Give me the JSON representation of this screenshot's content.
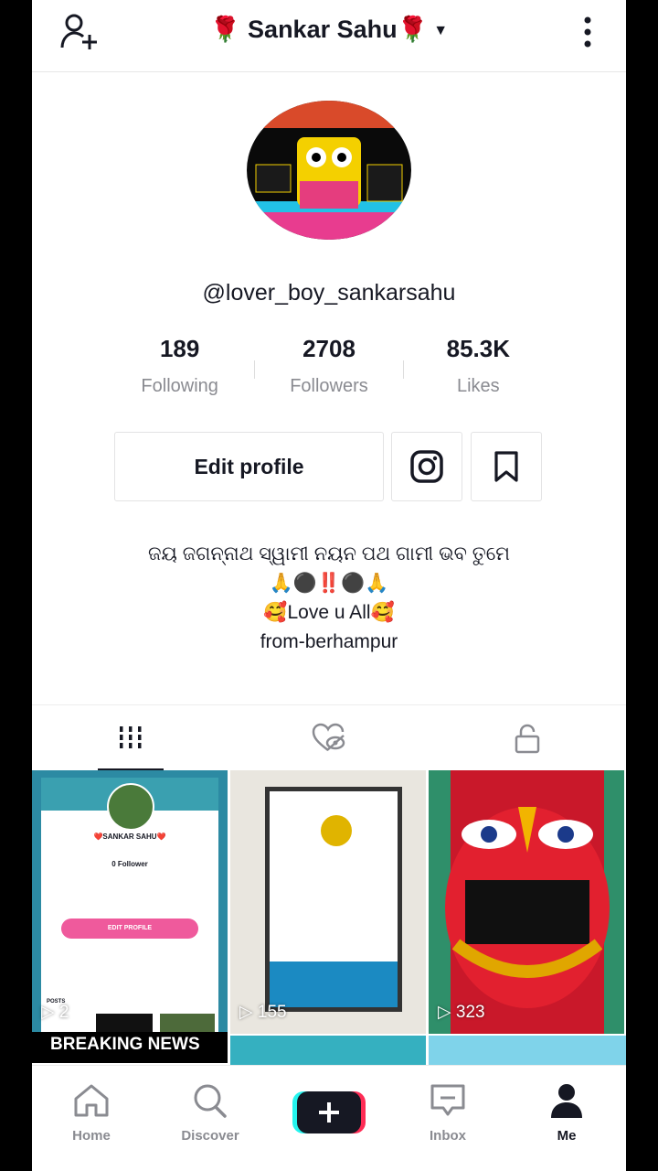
{
  "header": {
    "title": "🌹 Sankar Sahu🌹",
    "caret": "▼"
  },
  "profile": {
    "handle": "@lover_boy_sankarsahu",
    "stats": [
      {
        "value": "189",
        "label": "Following"
      },
      {
        "value": "2708",
        "label": "Followers"
      },
      {
        "value": "85.3K",
        "label": "Likes"
      }
    ],
    "edit_label": "Edit profile",
    "bio_lines": [
      "ଜୟ ଜଗନ୍ନାଥ ସ୍ୱାମୀ ନୟନ ପଥ ଗାମୀ ଭବ ତୁମେ",
      "🙏⚫‼️⚫🙏",
      "🥰Love u All🥰",
      "from-berhampur"
    ]
  },
  "videos": [
    {
      "views": "2",
      "overlay": "BREAKING NEWS",
      "inner_name": "❤️SANKAR SAHU❤️",
      "inner_followers": "0 Follower",
      "inner_button": "EDIT PROFILE",
      "inner_posts": "POSTS"
    },
    {
      "views": "155"
    },
    {
      "views": "323"
    }
  ],
  "nav": [
    {
      "label": "Home",
      "icon": "home-icon"
    },
    {
      "label": "Discover",
      "icon": "search-icon"
    },
    {
      "label": "",
      "icon": "plus-icon"
    },
    {
      "label": "Inbox",
      "icon": "inbox-icon"
    },
    {
      "label": "Me",
      "icon": "person-icon"
    }
  ],
  "colors": {
    "accent_cyan": "#25f4ee",
    "accent_red": "#fe2c55",
    "text": "#161823",
    "muted": "#8a8b91"
  }
}
